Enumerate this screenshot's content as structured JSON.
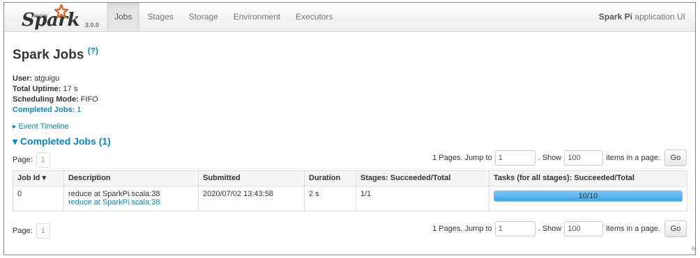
{
  "navbar": {
    "brand_apache": "APACHE",
    "brand_name": "Spark",
    "version": "3.0.0",
    "tabs": [
      {
        "label": "Jobs",
        "active": true
      },
      {
        "label": "Stages",
        "active": false
      },
      {
        "label": "Storage",
        "active": false
      },
      {
        "label": "Environment",
        "active": false
      },
      {
        "label": "Executors",
        "active": false
      }
    ],
    "app_name": "Spark Pi",
    "app_suffix": " application UI"
  },
  "page": {
    "title": "Spark Jobs",
    "help_link": "(?)"
  },
  "summary": {
    "user_label": "User:",
    "user": "atguigu",
    "uptime_label": "Total Uptime:",
    "uptime": "17 s",
    "mode_label": "Scheduling Mode:",
    "mode": "FIFO",
    "completed_label": "Completed Jobs:",
    "completed": "1"
  },
  "event_timeline": "Event Timeline",
  "completed_section": "Completed Jobs (1)",
  "pagination": {
    "page_label": "Page:",
    "current_page": "1",
    "pages_text": "1 Pages. Jump to",
    "jump_value": "1",
    "show_text": ". Show",
    "show_value": "100",
    "items_text": "items in a page.",
    "go_label": "Go"
  },
  "table": {
    "headers": [
      "Job Id ▾",
      "Description",
      "Submitted",
      "Duration",
      "Stages: Succeeded/Total",
      "Tasks (for all stages): Succeeded/Total"
    ],
    "rows": [
      {
        "job_id": "0",
        "description": "reduce at SparkPi.scala:38",
        "description_link": "reduce at SparkPi.scala:38",
        "submitted": "2020/07/02 13:43:58",
        "duration": "2 s",
        "stages": "1/1",
        "tasks": "10/10",
        "tasks_progress": 1.0
      }
    ]
  },
  "colors": {
    "link": "#0088cc",
    "progress": "#3da7e8"
  }
}
